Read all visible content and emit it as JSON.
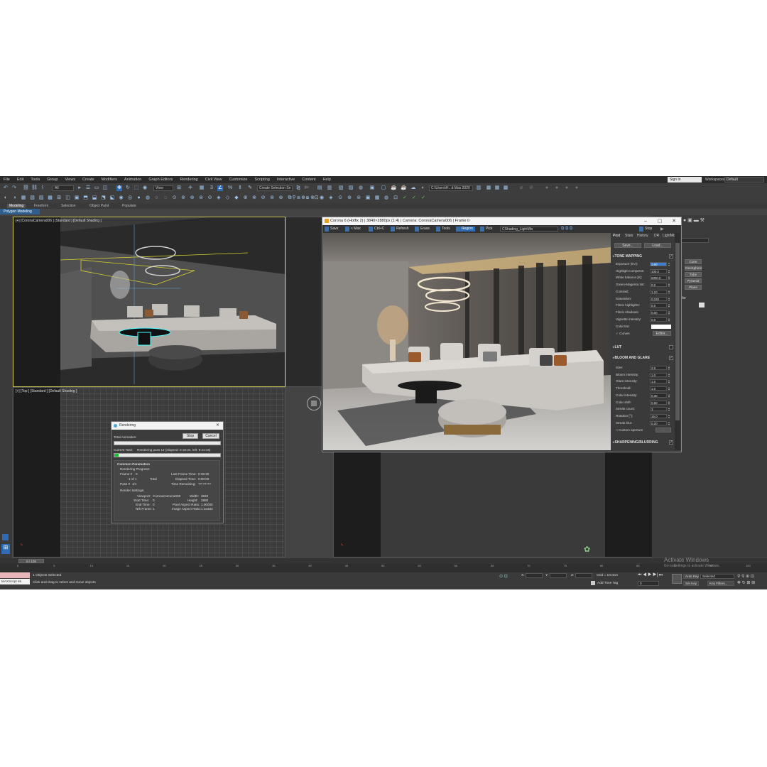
{
  "menu": [
    "File",
    "Edit",
    "Tools",
    "Group",
    "Views",
    "Create",
    "Modifiers",
    "Animation",
    "Graph Editors",
    "Rendering",
    "Civil View",
    "Customize",
    "Scripting",
    "Interactive",
    "Content",
    "Help"
  ],
  "signin": "Sign In",
  "workspaces_label": "Workspaces:",
  "workspaces_value": "Default",
  "toolbar": {
    "filter_all": "All",
    "view": "View",
    "selection_set": "Create Selection Se",
    "path": "C:\\Users\\H...d Max 2020"
  },
  "ribbon": {
    "tabs": [
      "Modeling",
      "Freeform",
      "Selection",
      "Object Paint",
      "Populate"
    ],
    "active": "Modeling",
    "sub": "Polygon Modeling"
  },
  "viewports": {
    "camera_label": "[+] [CoronaCamera006 ] [Standard ] [Default Shading ]",
    "top_label": "[+] [Top ] [Standard ] [Default Shading ]"
  },
  "vfb": {
    "title": "Corona 6 (Hotfix 2) | 3840×2880px (1:4) | Camera: CoronaCamera006 | Frame 0",
    "toolbar": [
      "Save",
      "< Max",
      "Ctrl+C",
      "Refresh",
      "Erase",
      "Tools",
      "Region",
      "Pick"
    ],
    "active_tool": "Region",
    "lightmix": "CShading_LightMix",
    "stop": "Stop",
    "tabs": [
      "Post",
      "Stats",
      "History",
      "DR",
      "LightMix"
    ],
    "save": "Save...",
    "load": "Load...",
    "tone_mapping": "TONE MAPPING",
    "tone_rows": [
      {
        "label": "Exposure (EV):",
        "value": "1.60",
        "hl": true
      },
      {
        "label": "Highlight compress:",
        "value": "100.0"
      },
      {
        "label": "White balance [K]:",
        "value": "6000.0"
      },
      {
        "label": "Green-Magenta tint:",
        "value": "0.0"
      },
      {
        "label": "Contrast:",
        "value": "1.10"
      },
      {
        "label": "Saturation:",
        "value": "0.020"
      },
      {
        "label": "Filmic highlights:",
        "value": "0.0"
      },
      {
        "label": "Filmic shadows:",
        "value": "0.00"
      },
      {
        "label": "Vignette intensity:",
        "value": "0.0"
      }
    ],
    "color_tint": "Color tint:",
    "curves": "Curves",
    "editor": "Editor...",
    "lut": "LUT",
    "bloom_glare": "BLOOM AND GLARE",
    "bloom_rows": [
      {
        "label": "Size:",
        "value": "2.0"
      },
      {
        "label": "Bloom intensity:",
        "value": "1.0"
      },
      {
        "label": "Glare intensity:",
        "value": "1.0"
      },
      {
        "label": "Threshold:",
        "value": "1.0"
      },
      {
        "label": "Color intensity:",
        "value": "0.30"
      },
      {
        "label": "Color shift:",
        "value": "0.50"
      },
      {
        "label": "Streak count:",
        "value": "3"
      },
      {
        "label": "Rotation [°]:",
        "value": "15.0"
      },
      {
        "label": "Streak blur:",
        "value": "0.20"
      }
    ],
    "custom_aperture": "Custom aperture",
    "sharpening": "SHARPENING/BLURRING"
  },
  "dialog": {
    "title": "Rendering",
    "total_animation": "Total Animation:",
    "stop": "Stop",
    "cancel": "Cancel",
    "current_task_label": "Current Task:",
    "current_task": "Rendering pass 12 (elapsed: 0:18:34, left: 9:41:16)",
    "common_params": "Common Parameters",
    "progress": "Rendering Progress:",
    "frame": "Frame #",
    "frame_val": "0",
    "of": "1 of 1",
    "total": "Total",
    "pass": "Pass #",
    "pass_val": "1/1",
    "last_frame": "Last Frame Time:",
    "last_frame_val": "0:36:30",
    "elapsed": "Elapsed Time:",
    "elapsed_val": "0:00:00",
    "remaining": "Time Remaining:",
    "remaining_val": "??:??:??",
    "render_settings": "Render Settings:",
    "viewport": "Viewport:",
    "viewport_val": "CoronaCamera006",
    "width": "Width:",
    "width_val": "3840",
    "start": "Start Time:",
    "start_val": "0",
    "height": "Height:",
    "height_val": "2880",
    "end": "End Time:",
    "end_val": "0",
    "pixel_aspect": "Pixel Aspect Ratio:",
    "pixel_aspect_val": "1.00000",
    "nth": "Nth Frame:",
    "nth_val": "1",
    "image_aspect": "Image Aspect Ratio:",
    "image_aspect_val": "1.33333",
    "progress_total": 0.0,
    "progress_task": 0.04
  },
  "command_panel": [
    "Cone",
    "GeoSphere",
    "Tube",
    "Pyramid",
    "Plane"
  ],
  "command_panel_color": "Color",
  "timeline": "0 / 100",
  "ruler_ticks": [
    "0",
    "5",
    "10",
    "15",
    "20",
    "25",
    "30",
    "35",
    "40",
    "45",
    "50",
    "55",
    "60",
    "65",
    "70",
    "75",
    "80",
    "85",
    "90",
    "95",
    "100"
  ],
  "status": {
    "script": "MAXScript Mi",
    "selected": "1 Objects Selected",
    "prompt": "Click and drag to select and move objects",
    "x": "X:",
    "y": "Y:",
    "z": "Z:",
    "grid": "Grid = 10.0cm",
    "add_time_tag": "Add Time Tag",
    "auto_key": "Auto Key",
    "set_key": "Set Key",
    "selected_dd": "Selected",
    "key_filters": "Key Filters...",
    "frame": "0"
  },
  "watermark": {
    "line1": "Activate Windows",
    "line2": "Go to Settings to activate Windows."
  }
}
